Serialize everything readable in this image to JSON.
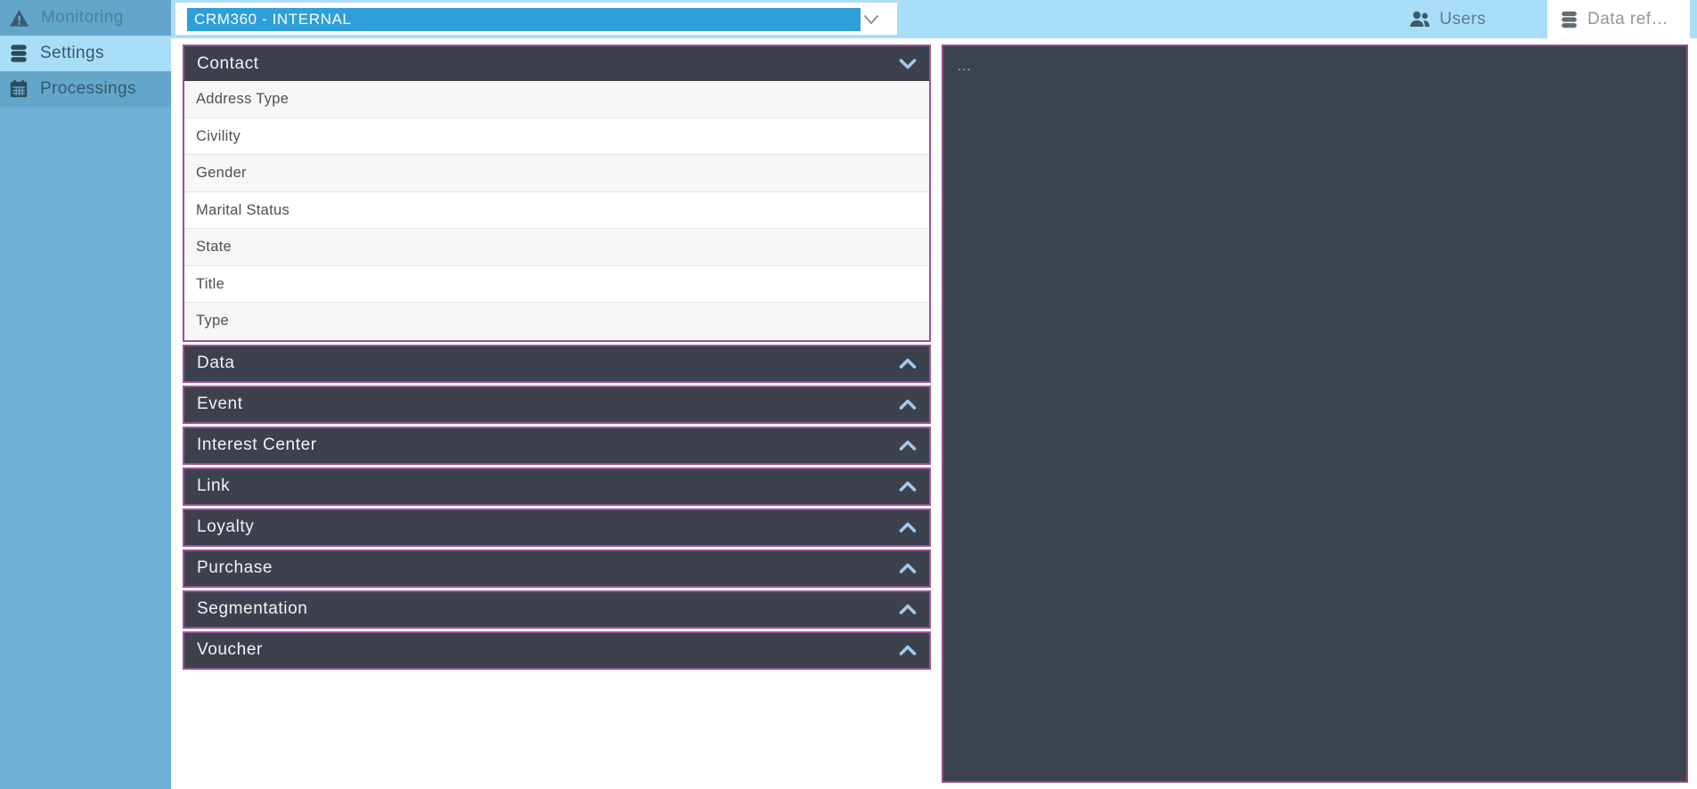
{
  "topbar": {
    "environment_select": {
      "value": "CRM360 - INTERNAL"
    },
    "users": {
      "label": "Users",
      "icon": "users"
    },
    "data_ref": {
      "label": "Data ref…",
      "icon": "database"
    }
  },
  "sidebar": {
    "items": [
      {
        "id": "monitoring",
        "label": "Monitoring",
        "icon": "warning",
        "selected": false,
        "muted": true
      },
      {
        "id": "settings",
        "label": "Settings",
        "icon": "database",
        "selected": true,
        "muted": false
      },
      {
        "id": "processings",
        "label": "Processings",
        "icon": "calendar",
        "selected": false,
        "muted": false
      }
    ]
  },
  "reference_accordion": {
    "sections": [
      {
        "label": "Contact",
        "expanded": true,
        "items": [
          "Address Type",
          "Civility",
          "Gender",
          "Marital Status",
          "State",
          "Title",
          "Type"
        ]
      },
      {
        "label": "Data",
        "expanded": false
      },
      {
        "label": "Event",
        "expanded": false
      },
      {
        "label": "Interest Center",
        "expanded": false
      },
      {
        "label": "Link",
        "expanded": false
      },
      {
        "label": "Loyalty",
        "expanded": false
      },
      {
        "label": "Purchase",
        "expanded": false
      },
      {
        "label": "Segmentation",
        "expanded": false
      },
      {
        "label": "Voucher",
        "expanded": false
      }
    ]
  },
  "detail_panel": {
    "placeholder_text": "..."
  },
  "colors": {
    "accent_blue": "#2D9FD9",
    "topbar_blue": "#A9DEF8",
    "sidebar_blue": "#6FB0D4",
    "sidebar_item_blue": "#63A6CA",
    "panel_border_purple": "#9C529B",
    "panel_header_dark": "#3C414D",
    "detail_border_purple": "#8D5287",
    "chevron_blue": "#A5C8EE"
  }
}
